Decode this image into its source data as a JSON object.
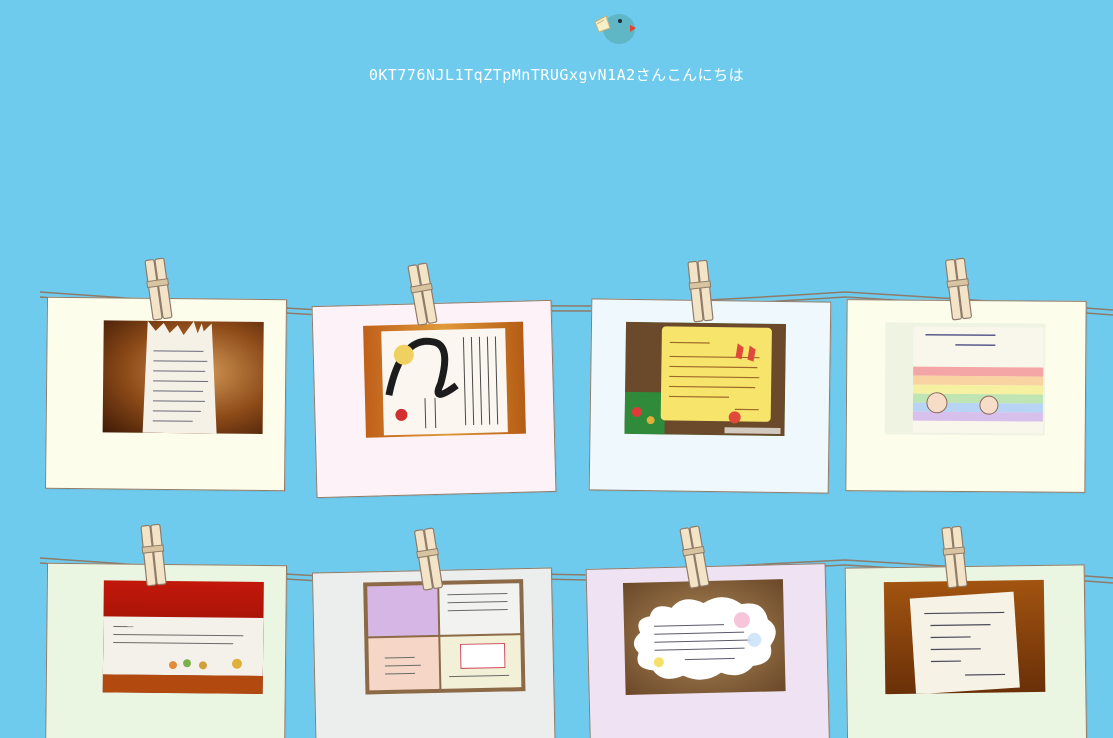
{
  "header": {
    "logo_icon": "bird-icon",
    "greeting": "0KT776NJL1TqZTpMnTRUGxgvN1A2さんこんにちは"
  },
  "colors": {
    "background": "#6ecbed",
    "string": "#8f7b69",
    "clip": "#f3e4c8"
  },
  "cards": [
    {
      "bg": "#fdfdec",
      "photo_icon": "handwritten-letter-photo"
    },
    {
      "bg": "#fdf2f8",
      "photo_icon": "calligraphy-letter-photo"
    },
    {
      "bg": "#eef8fd",
      "photo_icon": "game-screenshot-photo"
    },
    {
      "bg": "#fdfdec",
      "photo_icon": "rainbow-drawing-photo"
    },
    {
      "bg": "#eaf5e2",
      "photo_icon": "flower-note-photo"
    },
    {
      "bg": "#eceeee",
      "photo_icon": "greeting-cards-photo"
    },
    {
      "bg": "#efe3f3",
      "photo_icon": "cloud-note-photo"
    },
    {
      "bg": "#eaf5e2",
      "photo_icon": "sticky-note-photo"
    }
  ]
}
